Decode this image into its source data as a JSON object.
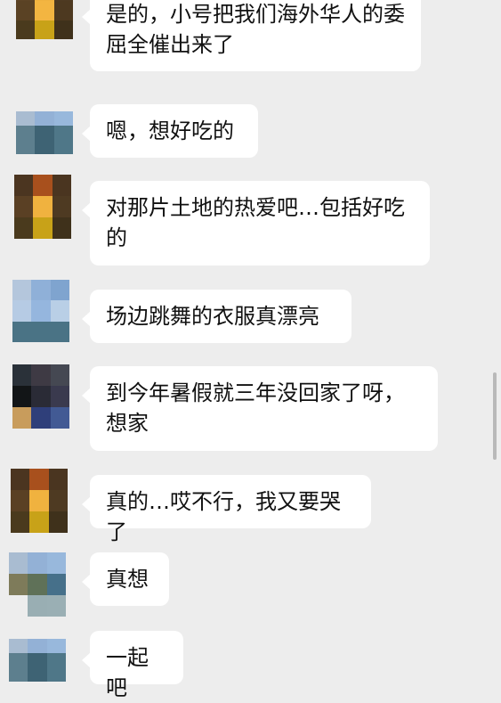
{
  "messages": [
    {
      "text": "是的，小号把我们海外华人的委屈全催出来了",
      "avatar": "avatar-brown-yellow"
    },
    {
      "text": "嗯，想好吃的",
      "avatar": "avatar-blue"
    },
    {
      "text": "对那片土地的热爱吧…包括好吃的",
      "avatar": "avatar-brown-yellow"
    },
    {
      "text": "场边跳舞的衣服真漂亮",
      "avatar": "avatar-light-blue"
    },
    {
      "text": "到今年暑假就三年没回家了呀，想家",
      "avatar": "avatar-dark"
    },
    {
      "text": "真的…哎不行，我又要哭了",
      "avatar": "avatar-brown-yellow"
    },
    {
      "text": "真想",
      "avatar": "avatar-green-blue"
    },
    {
      "text": "一起吧",
      "avatar": "avatar-blue"
    }
  ],
  "colors": {
    "background": "#ededed",
    "bubble": "#ffffff",
    "text": "#111111",
    "scrollbar": "#b9b9b9"
  }
}
